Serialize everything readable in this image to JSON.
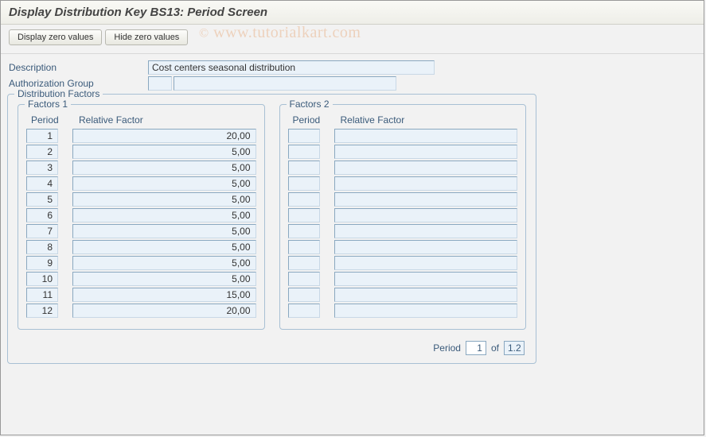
{
  "title": "Display Distribution Key BS13: Period Screen",
  "toolbar": {
    "display_zero": "Display zero values",
    "hide_zero": "Hide zero values"
  },
  "watermark": "www.tutorialkart.com",
  "form": {
    "description_label": "Description",
    "description_value": "Cost centers seasonal distribution",
    "auth_group_label": "Authorization Group",
    "auth_group_code": "",
    "auth_group_text": ""
  },
  "distribution_factors": {
    "title": "Distribution Factors",
    "col_period": "Period",
    "col_factor": "Relative Factor",
    "factors1": {
      "title": "Factors 1",
      "rows": [
        {
          "period": "1",
          "factor": "20,00"
        },
        {
          "period": "2",
          "factor": "5,00"
        },
        {
          "period": "3",
          "factor": "5,00"
        },
        {
          "period": "4",
          "factor": "5,00"
        },
        {
          "period": "5",
          "factor": "5,00"
        },
        {
          "period": "6",
          "factor": "5,00"
        },
        {
          "period": "7",
          "factor": "5,00"
        },
        {
          "period": "8",
          "factor": "5,00"
        },
        {
          "period": "9",
          "factor": "5,00"
        },
        {
          "period": "10",
          "factor": "5,00"
        },
        {
          "period": "11",
          "factor": "15,00"
        },
        {
          "period": "12",
          "factor": "20,00"
        }
      ]
    },
    "factors2": {
      "title": "Factors 2",
      "rows": [
        {
          "period": "",
          "factor": ""
        },
        {
          "period": "",
          "factor": ""
        },
        {
          "period": "",
          "factor": ""
        },
        {
          "period": "",
          "factor": ""
        },
        {
          "period": "",
          "factor": ""
        },
        {
          "period": "",
          "factor": ""
        },
        {
          "period": "",
          "factor": ""
        },
        {
          "period": "",
          "factor": ""
        },
        {
          "period": "",
          "factor": ""
        },
        {
          "period": "",
          "factor": ""
        },
        {
          "period": "",
          "factor": ""
        },
        {
          "period": "",
          "factor": ""
        }
      ]
    },
    "footer": {
      "period_label": "Period",
      "period_value": "1",
      "of_label": "of",
      "of_value": "1.2"
    }
  }
}
